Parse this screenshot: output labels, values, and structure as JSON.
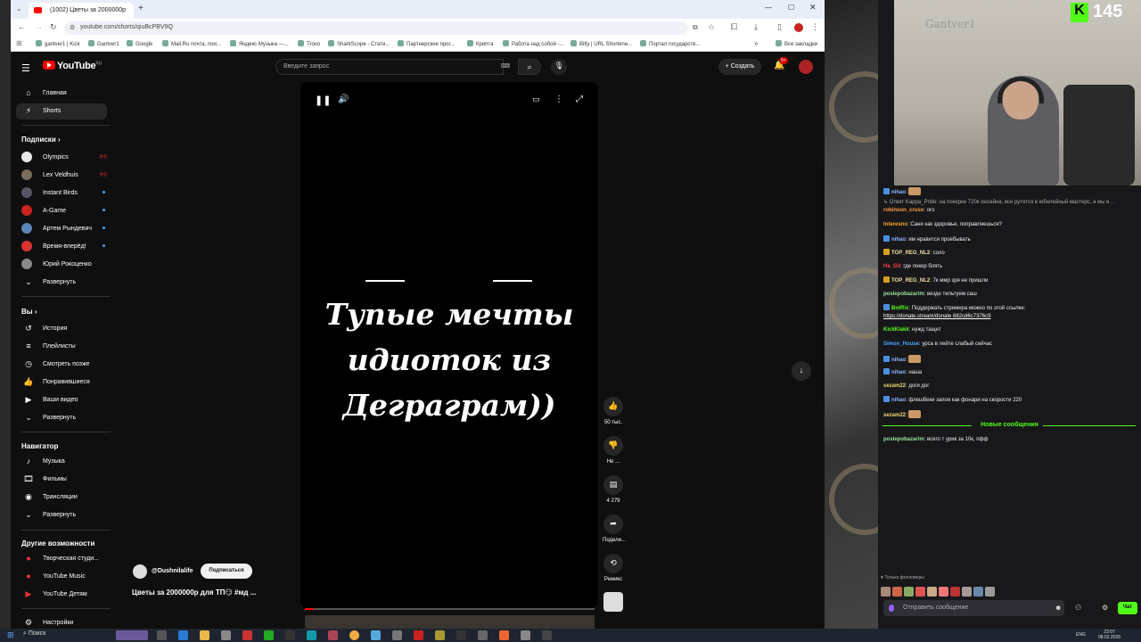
{
  "browser": {
    "tab_active_title": "(1002) Цветы за 2000000р",
    "new_tab_symbol": "+",
    "url": "youtube.com/shorts/qiuBcPBV9Q",
    "bookmarks": [
      "gantver1 | Kick",
      "Gantver1",
      "Google",
      "Mail.Ru почта, пои...",
      "Яндекс Музыка —...",
      "Trovo",
      "SharkScope - Стати...",
      "Партнерские прог...",
      "Крипта",
      "Работа над собой -...",
      "Bitly | URL Shortene...",
      "Портал государств...",
      "Все закладки"
    ]
  },
  "youtube": {
    "logo_text": "YouTube",
    "logo_region": "RU",
    "search_placeholder": "Введите запрос",
    "create_label": "Создать",
    "notif_count": "9+",
    "nav_main": [
      {
        "label": "Главная",
        "icon": "home-icon"
      },
      {
        "label": "Shorts",
        "icon": "shorts-icon"
      }
    ],
    "subscriptions_title": "Подписки",
    "subscriptions": [
      {
        "name": "Olympics",
        "color": "#e8e8e8",
        "status": "live"
      },
      {
        "name": "Lex Veldhuis",
        "color": "#7b6b5a",
        "status": "live"
      },
      {
        "name": "Instant Birds",
        "color": "#556",
        "status": "dot"
      },
      {
        "name": "A-Game",
        "color": "#c22",
        "status": "dot"
      },
      {
        "name": "Артем Рындевич",
        "color": "#5a86b5",
        "status": "dot"
      },
      {
        "name": "Время-вперёд!",
        "color": "#d33",
        "status": "dot"
      },
      {
        "name": "Юрий Рокоценко",
        "color": "#888",
        "status": "none"
      }
    ],
    "expand_label": "Развернуть",
    "you_title": "Вы",
    "you_items": [
      "История",
      "Плейлисты",
      "Смотреть позже",
      "Понравившиеся",
      "Ваши видео",
      "Развернуть"
    ],
    "navigator_title": "Навигатор",
    "navigator_items": [
      "Музыка",
      "Фильмы",
      "Трансляции",
      "Развернуть"
    ],
    "more_title": "Другие возможности",
    "more_items": [
      "Творческая студи...",
      "YouTube Music",
      "YouTube Детям"
    ],
    "settings_label": "Настройки",
    "video": {
      "overlay_lines": [
        "Тупые мечты",
        "идиоток из",
        "Деграграм))"
      ],
      "channel": "@Dushnilalife",
      "subscribe_label": "Подписаться",
      "title": "Цветы за 2000000р для ТП😏 #мд ...",
      "progress": 0.03
    },
    "actions": [
      {
        "icon": "like-icon",
        "label": "50 тыс."
      },
      {
        "icon": "dislike-icon",
        "label": "Не ..."
      },
      {
        "icon": "comments-icon",
        "label": "4 279"
      },
      {
        "icon": "share-icon",
        "label": "Подели..."
      },
      {
        "icon": "remix-icon",
        "label": "Ремикс"
      }
    ]
  },
  "stream": {
    "viewers": "145",
    "wall_sign": "Gantver1",
    "chat": [
      {
        "user": "nihao",
        "text": "",
        "color": "#8fb3ff",
        "badge": "#4a90e2"
      },
      {
        "user": "",
        "text": "↳ Ответ Kappa_Pride: на покерке 720к онлайна, все рутятся в юбилейный мастерс, а мы в ...",
        "color": "#aaa",
        "badge": ""
      },
      {
        "user": "robinson_cruso",
        "text": "ого",
        "color": "#ff9d3b",
        "badge": ""
      },
      {
        "user": "Interesno",
        "text": "Саня как здоровье, поправляешься?",
        "color": "#f5a623",
        "badge": ""
      },
      {
        "user": "nihao",
        "text": "им нравится проебывать",
        "color": "#8fb3ff",
        "badge": "#4a90e2"
      },
      {
        "user": "TOP_REG_NL2",
        "text": "соло",
        "color": "#f0e0a0",
        "badge": "#d4a017"
      },
      {
        "user": "Ha_Gil",
        "text": "где покер блять",
        "color": "#ff4040",
        "badge": ""
      },
      {
        "user": "TOP_REG_NL2",
        "text": "7к ммр зря не пришли",
        "color": "#f0e0a0",
        "badge": "#d4a017"
      },
      {
        "user": "poslepobazarim",
        "text": "везде тильтуем саш",
        "color": "#9be39b",
        "badge": ""
      },
      {
        "user": "BotRix",
        "text": "Поддержать стримера можно по этой ссылке:",
        "color": "#53fc18",
        "badge": "#4a90e2"
      },
      {
        "user": "",
        "text": "https://donate.stream/donate 682cd6c7376c9",
        "color": "#fff",
        "badge": ""
      },
      {
        "user": "KickKlakk",
        "text": "нужд тащит",
        "color": "#53fc18",
        "badge": ""
      },
      {
        "user": "Simon_House",
        "text": "урса в лейте слабый сейчас",
        "color": "#4aa8ff",
        "badge": ""
      },
      {
        "user": "nihao",
        "text": "",
        "color": "#8fb3ff",
        "badge": "#4a90e2"
      },
      {
        "user": "nihao",
        "text": "наша",
        "color": "#8fb3ff",
        "badge": "#4a90e2"
      },
      {
        "user": "sezam22",
        "text": "доги дог",
        "color": "#f5d76e",
        "badge": ""
      },
      {
        "user": "nihao",
        "text": "флешбеки запоя как фонари на скорости 220",
        "color": "#8fb3ff",
        "badge": "#4a90e2"
      },
      {
        "user": "sezam22",
        "text": "",
        "color": "#f5d76e",
        "badge": ""
      }
    ],
    "new_messages_label": "Новые сообщения",
    "after_new": [
      {
        "user": "poslepobazarim",
        "text": "всего т урик за 10к, пфф",
        "color": "#9be39b",
        "badge": ""
      }
    ],
    "followers_only": "Только фолловеры",
    "chat_placeholder": "Отправить сообщение",
    "chat_button": "Чат"
  },
  "taskbar": {
    "search_label": "Поиск",
    "lang": "ENG",
    "time": "23:07",
    "date": "08.02.2026"
  }
}
